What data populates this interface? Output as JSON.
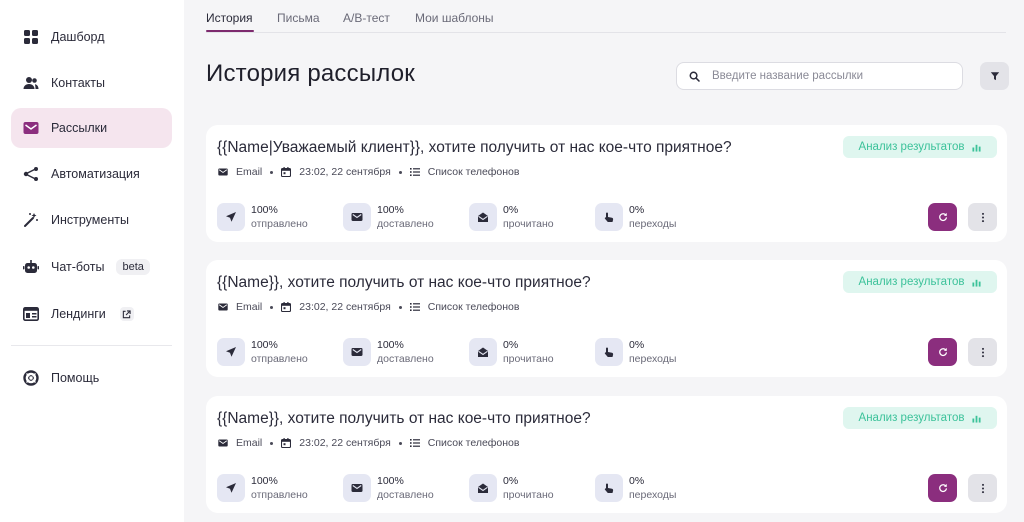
{
  "sidebar": {
    "items": [
      {
        "label": "Дашборд",
        "icon": "dashboard-icon"
      },
      {
        "label": "Контакты",
        "icon": "contacts-icon"
      },
      {
        "label": "Рассылки",
        "icon": "mail-icon",
        "active": true
      },
      {
        "label": "Автоматизация",
        "icon": "automation-icon"
      },
      {
        "label": "Инструменты",
        "icon": "tools-icon"
      },
      {
        "label": "Чат-боты",
        "icon": "bot-icon",
        "badge": "beta"
      },
      {
        "label": "Лендинги",
        "icon": "landing-icon",
        "external": true
      }
    ],
    "help": {
      "label": "Помощь",
      "icon": "help-icon"
    }
  },
  "tabs": [
    {
      "label": "История"
    },
    {
      "label": "Письма"
    },
    {
      "label": "A/B-тест"
    },
    {
      "label": "Мои шаблоны"
    }
  ],
  "page": {
    "title": "История рассылок",
    "search_placeholder": "Введите название рассылки"
  },
  "colors": {
    "accent": "#8b2e7e",
    "active_nav_bg": "#f5e5ee",
    "analysis_green": "#3cc29a"
  },
  "mailings": [
    {
      "title": "{{Name|Уважаемый клиент}}, хотите получить от нас кое-что приятное?",
      "analysis_label": "Анализ результатов",
      "channel": "Email",
      "datetime": "23:02, 22 сентября",
      "list": "Список телефонов",
      "stats": [
        {
          "value": "100%",
          "label": "отправлено"
        },
        {
          "value": "100%",
          "label": "доставлено"
        },
        {
          "value": "0%",
          "label": "прочитано"
        },
        {
          "value": "0%",
          "label": "переходы"
        }
      ]
    },
    {
      "title": "{{Name}}, хотите получить от нас кое-что приятное?",
      "analysis_label": "Анализ результатов",
      "channel": "Email",
      "datetime": "23:02, 22 сентября",
      "list": "Список телефонов",
      "stats": [
        {
          "value": "100%",
          "label": "отправлено"
        },
        {
          "value": "100%",
          "label": "доставлено"
        },
        {
          "value": "0%",
          "label": "прочитано"
        },
        {
          "value": "0%",
          "label": "переходы"
        }
      ]
    },
    {
      "title": "{{Name}}, хотите получить от нас кое-что приятное?",
      "analysis_label": "Анализ результатов",
      "channel": "Email",
      "datetime": "23:02, 22 сентября",
      "list": "Список телефонов",
      "stats": [
        {
          "value": "100%",
          "label": "отправлено"
        },
        {
          "value": "100%",
          "label": "доставлено"
        },
        {
          "value": "0%",
          "label": "прочитано"
        },
        {
          "value": "0%",
          "label": "переходы"
        }
      ]
    }
  ]
}
